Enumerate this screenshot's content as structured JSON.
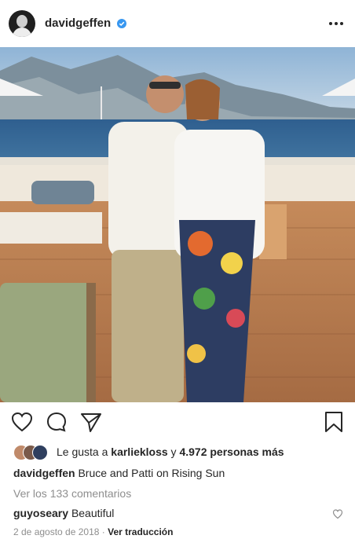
{
  "post": {
    "username": "davidgeffen",
    "verified": true,
    "photo_alt": "Bruce and Patti on a yacht deck",
    "likes": {
      "prefix": "Le gusta a ",
      "user": "karliekloss",
      "joiner": " y ",
      "count_text": "4.972 personas más"
    },
    "caption": {
      "username": "davidgeffen",
      "text": "Bruce and Patti on Rising Sun"
    },
    "view_comments": "Ver los 133 comentarios",
    "comment": {
      "username": "guyoseary",
      "text": "Beautiful"
    },
    "date": "2 de agosto de 2018",
    "separator": " · ",
    "translate": "Ver traducción"
  },
  "icons": {
    "like": "heart-icon",
    "comment": "comment-icon",
    "share": "send-icon",
    "save": "bookmark-icon",
    "more": "more-options-icon",
    "verified": "verified-badge-icon"
  },
  "colors": {
    "text": "#262626",
    "muted": "#8e8e8e",
    "verified": "#3897f0"
  }
}
